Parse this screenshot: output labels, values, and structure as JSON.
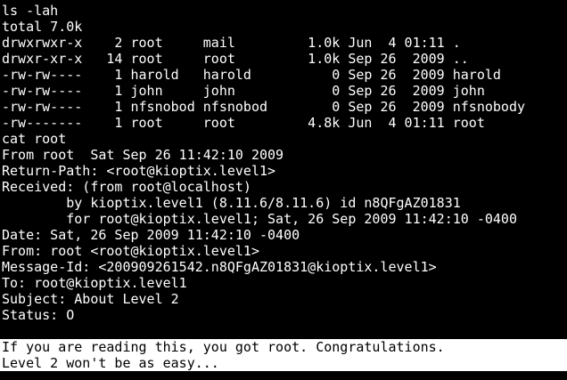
{
  "terminal": {
    "colors": {
      "background": "#000000",
      "foreground": "#ffffff",
      "selection_bg": "#ffffff",
      "selection_fg": "#000000"
    },
    "lines": [
      "ls -lah",
      "total 7.0k",
      "drwxrwxr-x    2 root     mail         1.0k Jun  4 01:11 .",
      "drwxr-xr-x   14 root     root         1.0k Sep 26  2009 ..",
      "-rw-rw----    1 harold   harold          0 Sep 26  2009 harold",
      "-rw-rw----    1 john     john            0 Sep 26  2009 john",
      "-rw-rw----    1 nfsnobod nfsnobod        0 Sep 26  2009 nfsnobody",
      "-rw-------    1 root     root         4.8k Jun  4 01:11 root",
      "cat root",
      "From root  Sat Sep 26 11:42:10 2009",
      "Return-Path: <root@kioptix.level1>",
      "Received: (from root@localhost)",
      "        by kioptix.level1 (8.11.6/8.11.6) id n8QFgAZ01831",
      "        for root@kioptix.level1; Sat, 26 Sep 2009 11:42:10 -0400",
      "Date: Sat, 26 Sep 2009 11:42:10 -0400",
      "From: root <root@kioptix.level1>",
      "Message-Id: <200909261542.n8QFgAZ01831@kioptix.level1>",
      "To: root@kioptix.level1",
      "Subject: About Level 2",
      "Status: O",
      ""
    ],
    "selected_lines": [
      "If you are reading this, you got root. Congratulations.",
      "Level 2 won't be as easy..."
    ]
  }
}
